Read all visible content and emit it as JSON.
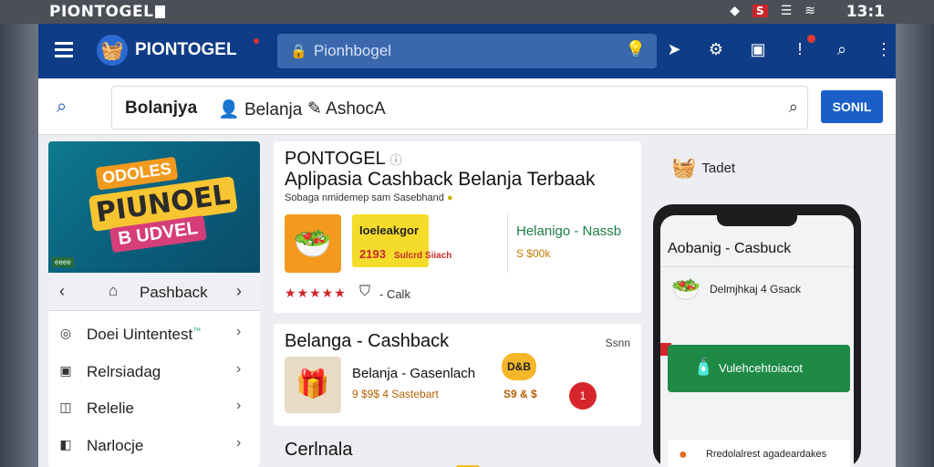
{
  "status_bar": {
    "title": "PIONTOGEL",
    "red_badge": "S",
    "time": "13:1"
  },
  "app_bar": {
    "brand": "PIONTOGEL",
    "search_placeholder": "Pionhbogel"
  },
  "sub_bar": {
    "tabs": [
      "Bolanjya",
      "Belanja",
      "AshocA"
    ],
    "button_label": "SONIL"
  },
  "left_panel": {
    "banner": {
      "top": "ODOLES",
      "middle": "PIUNOEL",
      "bottom": "B UDVEL",
      "foot": "eeee"
    },
    "pager_label": "Pashback",
    "items": [
      {
        "label": "Doei Uintentest",
        "sup": "™"
      },
      {
        "label": "Relrsiadag"
      },
      {
        "label": "Relelie"
      },
      {
        "label": "Narlocje"
      }
    ]
  },
  "card1": {
    "title": "PONTOGEL",
    "subtitle": "Aplipasia Cashback Belanja Terbaak",
    "small": "Sobaga nmidemep sam Sasebhand",
    "yellow_a": "Ioeleakgor",
    "yellow_b": "2193",
    "red_text": "Sulcrd Siiach",
    "green_title": "Helanigo - Nassb",
    "green_sub": "S $00k",
    "stars": "★★★★★",
    "talk": "- Calk"
  },
  "card2": {
    "title": "Belanga - Cashback",
    "sn": "Ssnn",
    "line1": "Belanja - Gasenlach",
    "line2": "9 $9$ 4 Sastebart",
    "coin": "D&B",
    "price": "S9 & $",
    "red": "1"
  },
  "card3": {
    "title": "Cerlnala"
  },
  "right_panel": {
    "head_label": "Tadet",
    "phone_title": "Aobanig - Casbuck",
    "phone_item": "Delmjhkaj 4 Gsack",
    "green_button": "Vulehcehtoiacot",
    "bottom_label": "Rredolalrest agadeardakes"
  }
}
